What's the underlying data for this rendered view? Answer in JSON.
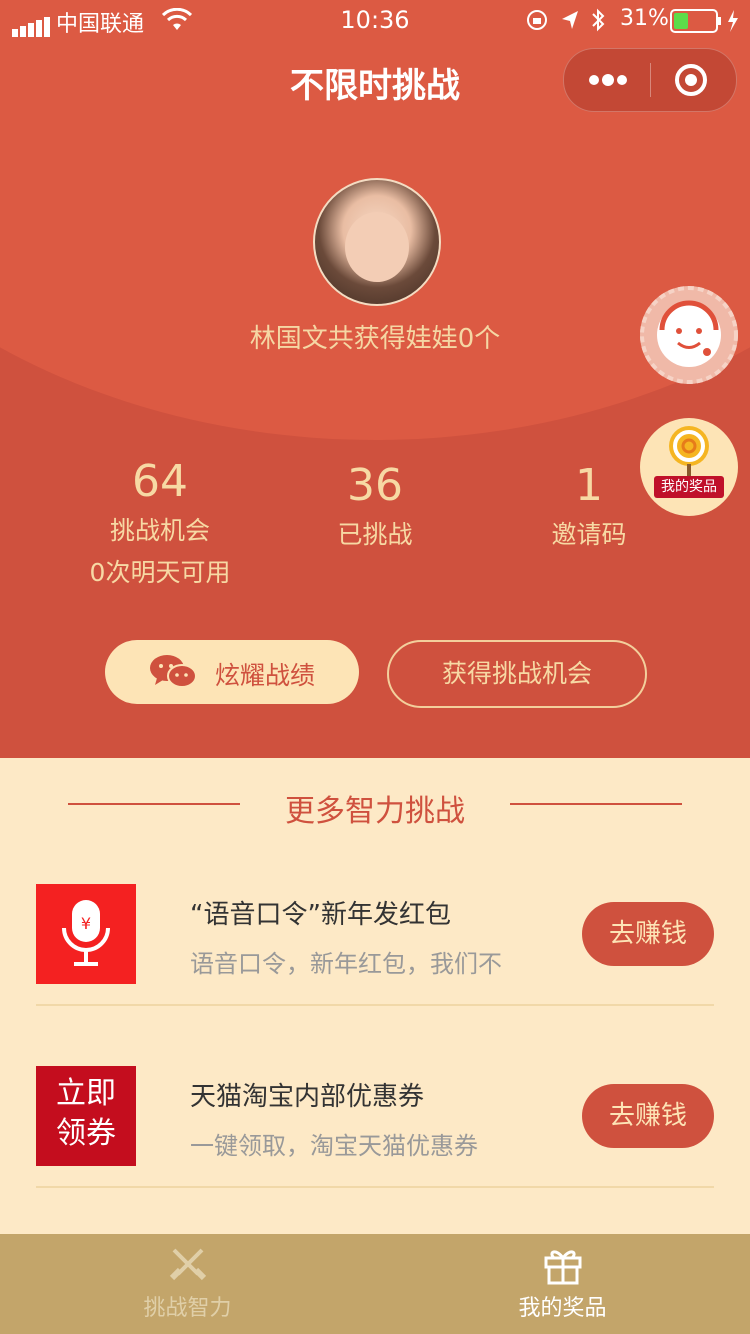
{
  "status_bar": {
    "carrier": "中国联通",
    "time": "10:36",
    "battery": "31%"
  },
  "nav": {
    "title": "不限时挑战"
  },
  "profile": {
    "summary": "林国文共获得娃娃0个"
  },
  "stats": [
    {
      "value": "64",
      "label": "挑战机会",
      "sub": "0次明天可用"
    },
    {
      "value": "36",
      "label": "已挑战"
    },
    {
      "value": "1",
      "label": "邀请码"
    }
  ],
  "actions": {
    "share_label": "炫耀战绩",
    "get_chance_label": "获得挑战机会"
  },
  "floating": {
    "prize_label": "我的奖品"
  },
  "section": {
    "title": "更多智力挑战"
  },
  "list": [
    {
      "icon": "red-envelope-voice-icon",
      "title": "“语音口令”新年发红包",
      "desc": "语音口令，新年红包，我们不",
      "button": "去赚钱"
    },
    {
      "thumb_text_1": "立即",
      "thumb_text_2": "领券",
      "title": "天猫淘宝内部优惠券",
      "desc": "一键领取，淘宝天猫优惠券",
      "button": "去赚钱"
    }
  ],
  "tabbar": {
    "tabs": [
      {
        "label": "挑战智力",
        "active": false
      },
      {
        "label": "我的奖品",
        "active": true
      }
    ]
  },
  "colors": {
    "primary_red": "#cf513e",
    "cream": "#fde9c6",
    "gold_text": "#f7d9a4",
    "tabbar_bg": "#c3a56a"
  }
}
